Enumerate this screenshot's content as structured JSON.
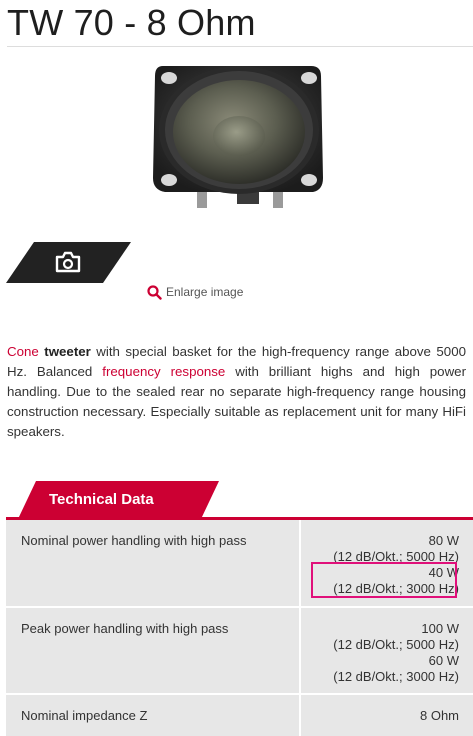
{
  "product": {
    "title": "TW 70 - 8 Ohm"
  },
  "gallery": {
    "enlarge_label": "Enlarge image"
  },
  "description": {
    "part1": "Cone",
    "part2": "tweeter",
    "part3": " with special basket for the high-frequency range above 5000 Hz. Balanced ",
    "link": "frequency response",
    "part4": " with brilliant highs and high power handling. Due to the sealed rear no separate high-frequency range housing construction necessary. Especially suitable as replacement unit for many HiFi speakers."
  },
  "technical_data": {
    "heading": "Technical Data",
    "rows": [
      {
        "label": "Nominal power handling with high pass",
        "values": [
          "80 W",
          "(12 dB/Okt.; 5000 Hz)",
          "40 W",
          "(12 dB/Okt.; 3000 Hz)"
        ]
      },
      {
        "label": "Peak power handling with high pass",
        "values": [
          "100 W",
          "(12 dB/Okt.; 5000 Hz)",
          "60 W",
          "(12 dB/Okt.; 3000 Hz)"
        ]
      },
      {
        "label": "Nominal impedance Z",
        "values": [
          "8 Ohm"
        ]
      }
    ]
  },
  "colors": {
    "accent": "#cc0033",
    "highlight_box": "#e0107a",
    "table_bg": "#e7e7e7",
    "tab_dark": "#222222"
  },
  "icons": {
    "camera": "camera-icon",
    "search": "search-icon"
  }
}
